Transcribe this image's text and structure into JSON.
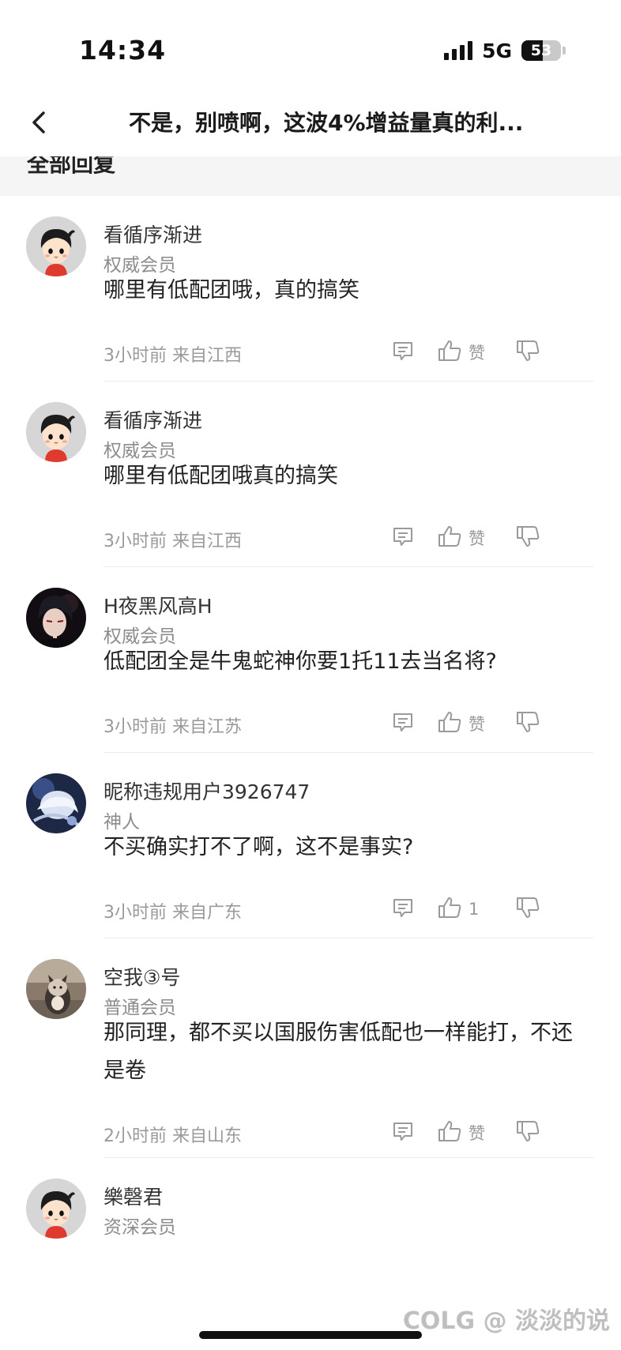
{
  "status_bar": {
    "time": "14:34",
    "network": "5G",
    "battery": "53",
    "battery_level": 0.53
  },
  "nav": {
    "title": "不是，别喷啊，这波4%增益量真的利..."
  },
  "section": {
    "title": "全部回复"
  },
  "comments": [
    {
      "username": "看循序渐进",
      "rank": "权威会员",
      "text": "哪里有低配团哦，真的搞笑",
      "time": "3小时前 来自江西",
      "like_label": "赞",
      "avatar": "cartoon-boy"
    },
    {
      "username": "看循序渐进",
      "rank": "权威会员",
      "text": "哪里有低配团哦真的搞笑",
      "time": "3小时前 来自江西",
      "like_label": "赞",
      "avatar": "cartoon-boy"
    },
    {
      "username": "H夜黑风高H",
      "rank": "权威会员",
      "text": "低配团全是牛鬼蛇神你要1托11去当名将?",
      "time": "3小时前 来自江苏",
      "like_label": "赞",
      "avatar": "dark-anime"
    },
    {
      "username": "昵称违规用户3926747",
      "rank": "神人",
      "text": "不买确实打不了啊，这不是事实?",
      "time": "3小时前 来自广东",
      "like_label": "1",
      "avatar": "blue-anime"
    },
    {
      "username": "空我③号",
      "rank": "普通会员",
      "text": "那同理，都不买以国服伤害低配也一样能打，不还是卷",
      "time": "2小时前 来自山东",
      "like_label": "赞",
      "avatar": "cat-photo"
    },
    {
      "username": "樂磬君",
      "rank": "资深会员",
      "text": "",
      "time": "",
      "like_label": "",
      "avatar": "cartoon-boy"
    }
  ],
  "watermark": "COLG @ 淡淡的说"
}
